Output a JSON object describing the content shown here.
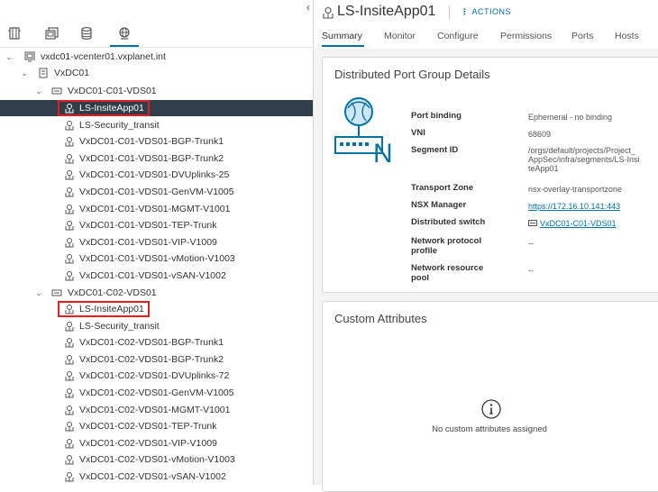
{
  "left_pane": {
    "collapse_glyph": "‹",
    "view_tabs": [
      {
        "name": "hosts-clusters-icon"
      },
      {
        "name": "vms-templates-icon"
      },
      {
        "name": "storage-icon"
      },
      {
        "name": "networking-icon"
      }
    ],
    "tree": {
      "vcenter": "vxdc01-vcenter01.vxplanet.int",
      "datacenter": "VxDC01",
      "switch1": {
        "label": "VxDC01-C01-VDS01",
        "items": [
          "LS-InsiteApp01",
          "LS-Security_transit",
          "VxDC01-C01-VDS01-BGP-Trunk1",
          "VxDC01-C01-VDS01-BGP-Trunk2",
          "VxDC01-C01-VDS01-DVUplinks-25",
          "VxDC01-C01-VDS01-GenVM-V1005",
          "VxDC01-C01-VDS01-MGMT-V1001",
          "VxDC01-C01-VDS01-TEP-Trunk",
          "VxDC01-C01-VDS01-VIP-V1009",
          "VxDC01-C01-VDS01-vMotion-V1003",
          "VxDC01-C01-VDS01-vSAN-V1002"
        ]
      },
      "switch2": {
        "label": "VxDC01-C02-VDS01",
        "items": [
          "LS-InsiteApp01",
          "LS-Security_transit",
          "VxDC01-C02-VDS01-BGP-Trunk1",
          "VxDC01-C02-VDS01-BGP-Trunk2",
          "VxDC01-C02-VDS01-DVUplinks-72",
          "VxDC01-C02-VDS01-GenVM-V1005",
          "VxDC01-C02-VDS01-MGMT-V1001",
          "VxDC01-C02-VDS01-TEP-Trunk",
          "VxDC01-C02-VDS01-VIP-V1009",
          "VxDC01-C02-VDS01-vMotion-V1003",
          "VxDC01-C02-VDS01-vSAN-V1002"
        ]
      }
    }
  },
  "header": {
    "title": "LS-InsiteApp01",
    "actions_dots": "⋮",
    "actions_label": "ACTIONS",
    "tabs": [
      "Summary",
      "Monitor",
      "Configure",
      "Permissions",
      "Ports",
      "Hosts"
    ]
  },
  "details_card": {
    "title": "Distributed Port Group Details",
    "grip": "⠿",
    "rows": [
      {
        "label": "Port binding",
        "value": "Ephemeral - no binding"
      },
      {
        "label": "VNI",
        "value": "68609"
      },
      {
        "label": "Segment ID",
        "value": "/orgs/default/projects/Project_AppSec/infra/segments/LS-InsiteApp01"
      },
      {
        "label": "Transport Zone",
        "value": "nsx-overlay-transportzone"
      },
      {
        "label": "NSX Manager",
        "value": "https://172.16.10.141:443"
      },
      {
        "label": "Distributed switch",
        "value": "VxDC01-C01-VDS01"
      },
      {
        "label": "Network protocol profile",
        "value": "--"
      },
      {
        "label": "Network resource pool",
        "value": "--"
      }
    ]
  },
  "custom_attributes_card": {
    "title": "Custom Attributes",
    "grip": "⠿",
    "empty_text": "No custom attributes assigned"
  }
}
